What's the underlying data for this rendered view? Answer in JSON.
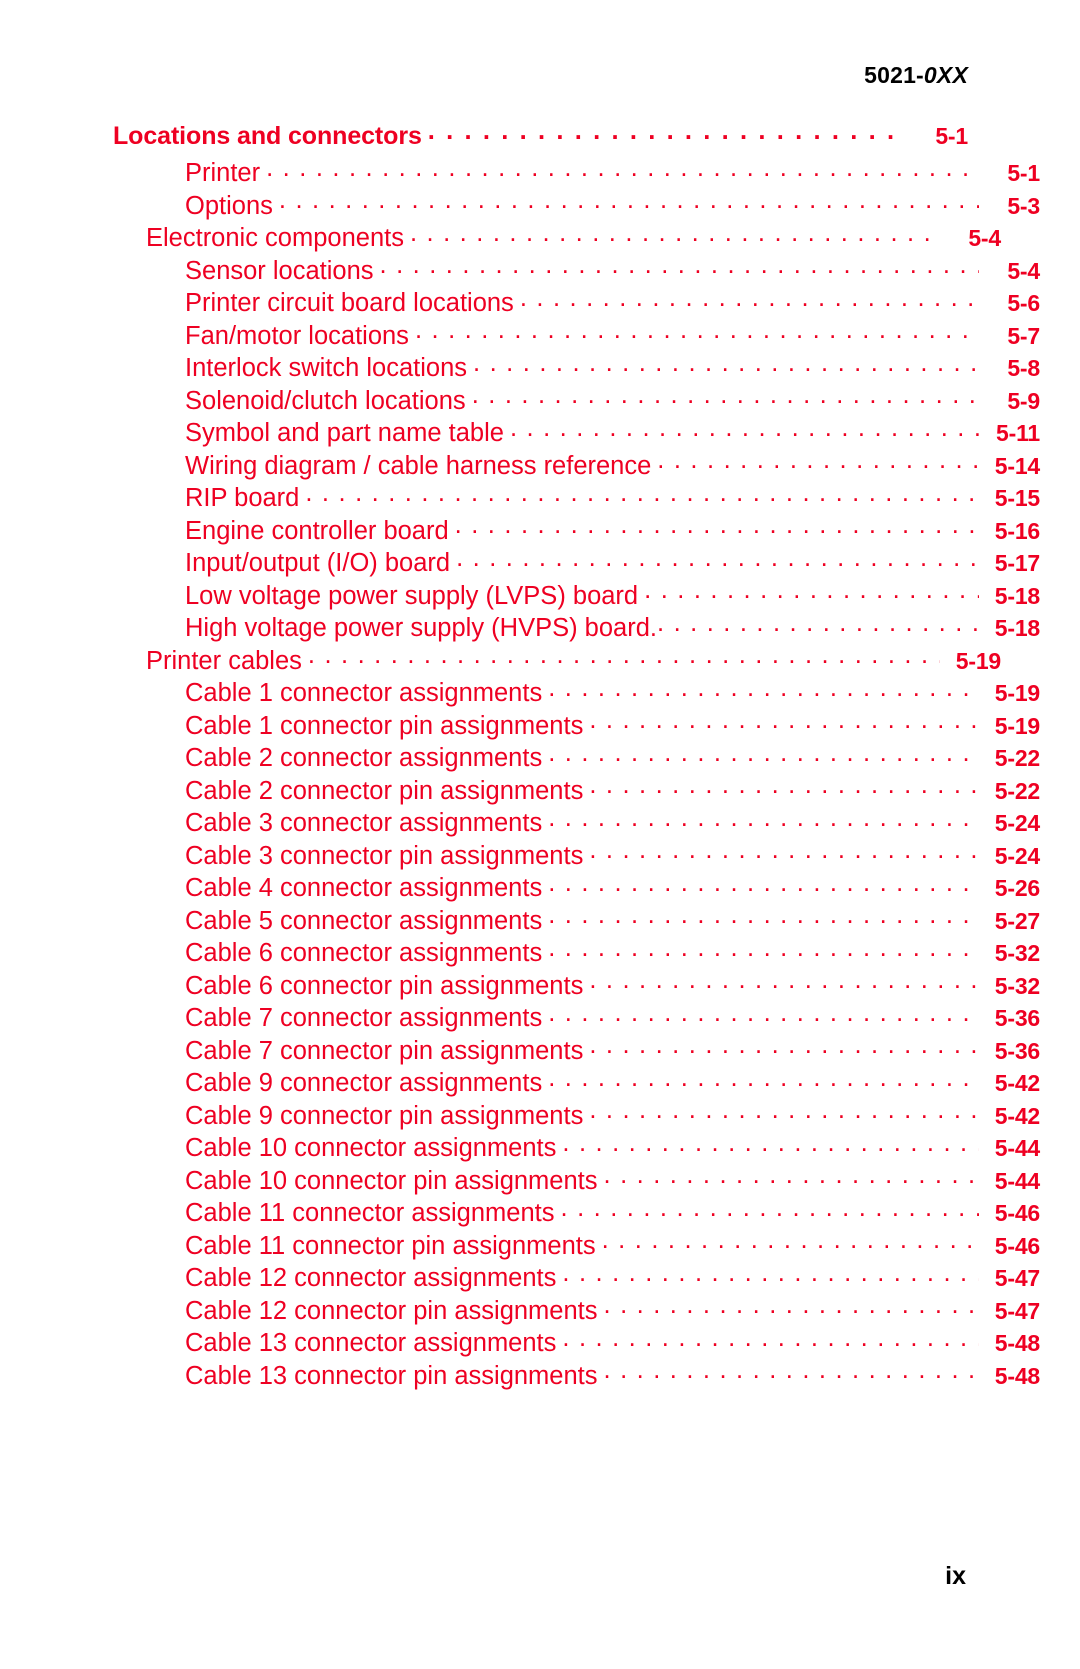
{
  "header": {
    "prefix": "5021-",
    "suffix": "0XX"
  },
  "footer": {
    "page_label": "ix"
  },
  "colors": {
    "entry_red": "#ee0022",
    "header_black": "#000000",
    "background": "#ffffff"
  },
  "toc": {
    "entries": [
      {
        "level": 1,
        "title": "Locations and connectors",
        "page": "5-1"
      },
      {
        "level": 3,
        "title": "Printer",
        "page": "5-1"
      },
      {
        "level": 3,
        "title": "Options",
        "page": "5-3"
      },
      {
        "level": 2,
        "title": "Electronic components",
        "page": "5-4"
      },
      {
        "level": 3,
        "title": "Sensor locations",
        "page": "5-4"
      },
      {
        "level": 3,
        "title": "Printer circuit board locations",
        "page": "5-6"
      },
      {
        "level": 3,
        "title": "Fan/motor locations",
        "page": "5-7"
      },
      {
        "level": 3,
        "title": "Interlock switch locations",
        "page": "5-8"
      },
      {
        "level": 3,
        "title": "Solenoid/clutch locations",
        "page": "5-9"
      },
      {
        "level": 3,
        "title": "Symbol and part name table",
        "page": "5-11"
      },
      {
        "level": 3,
        "title": "Wiring diagram / cable harness reference",
        "page": "5-14"
      },
      {
        "level": 3,
        "title": "RIP board",
        "page": "5-15"
      },
      {
        "level": 3,
        "title": "Engine controller board",
        "page": "5-16"
      },
      {
        "level": 3,
        "title": "Input/output (I/O) board",
        "page": "5-17"
      },
      {
        "level": 3,
        "title": "Low voltage power supply (LVPS) board",
        "page": "5-18"
      },
      {
        "level": 3,
        "title": "High voltage power supply (HVPS) board.",
        "page": "5-18"
      },
      {
        "level": 2,
        "title": "Printer cables",
        "page": "5-19"
      },
      {
        "level": 3,
        "title": "Cable 1 connector assignments",
        "page": "5-19"
      },
      {
        "level": 3,
        "title": "Cable 1 connector pin assignments",
        "page": "5-19"
      },
      {
        "level": 3,
        "title": "Cable 2 connector assignments",
        "page": "5-22"
      },
      {
        "level": 3,
        "title": "Cable 2 connector pin assignments",
        "page": "5-22"
      },
      {
        "level": 3,
        "title": "Cable 3 connector assignments",
        "page": "5-24"
      },
      {
        "level": 3,
        "title": "Cable 3 connector pin assignments",
        "page": "5-24"
      },
      {
        "level": 3,
        "title": "Cable 4 connector assignments",
        "page": "5-26"
      },
      {
        "level": 3,
        "title": "Cable 5 connector assignments",
        "page": "5-27"
      },
      {
        "level": 3,
        "title": "Cable 6 connector assignments",
        "page": "5-32"
      },
      {
        "level": 3,
        "title": "Cable 6 connector pin assignments",
        "page": "5-32"
      },
      {
        "level": 3,
        "title": "Cable 7 connector assignments",
        "page": "5-36"
      },
      {
        "level": 3,
        "title": "Cable 7 connector pin assignments",
        "page": "5-36"
      },
      {
        "level": 3,
        "title": "Cable 9 connector assignments",
        "page": "5-42"
      },
      {
        "level": 3,
        "title": "Cable 9 connector pin assignments",
        "page": "5-42"
      },
      {
        "level": 3,
        "title": "Cable 10 connector assignments",
        "page": "5-44"
      },
      {
        "level": 3,
        "title": "Cable 10 connector pin assignments",
        "page": "5-44"
      },
      {
        "level": 3,
        "title": "Cable 11 connector assignments",
        "page": "5-46"
      },
      {
        "level": 3,
        "title": "Cable 11 connector pin assignments",
        "page": "5-46"
      },
      {
        "level": 3,
        "title": "Cable 12 connector assignments",
        "page": "5-47"
      },
      {
        "level": 3,
        "title": "Cable 12 connector pin assignments",
        "page": "5-47"
      },
      {
        "level": 3,
        "title": "Cable 13 connector assignments",
        "page": "5-48"
      },
      {
        "level": 3,
        "title": "Cable 13 connector pin assignments",
        "page": "5-48"
      }
    ]
  }
}
